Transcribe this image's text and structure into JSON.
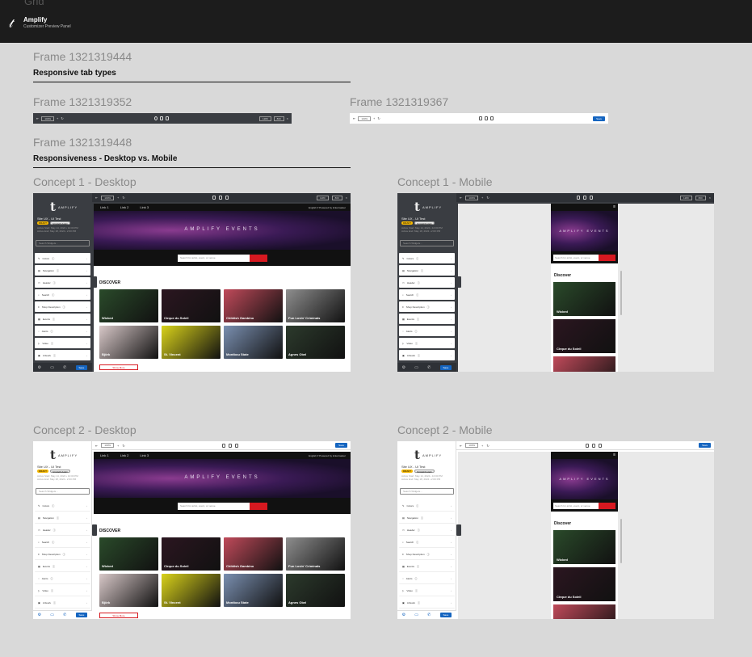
{
  "app": {
    "ghost_title": "Grid",
    "title": "Amplify",
    "subtitle": "Customizer Preview Panel"
  },
  "frames": {
    "f1": "Frame 1321319444",
    "f2": "Frame 1321319352",
    "f3": "Frame 1321319367",
    "f4": "Frame 1321319448"
  },
  "sections": {
    "tab_types": "Responsive tab types",
    "responsiveness": "Responsiveness - Desktop vs. Mobile"
  },
  "concepts": {
    "c1d": "Concept 1 - Desktop",
    "c1m": "Concept 1 - Mobile",
    "c2d": "Concept 2 - Desktop",
    "c2m": "Concept 2 - Mobile"
  },
  "toolbar": {
    "zoom": "100%",
    "field1": "1280",
    "field2": "800",
    "save": "Save"
  },
  "sidebar": {
    "brand": "AMPLIFY",
    "site_name": "Site UX - UI Test",
    "badge_a": "DRAFT",
    "badge_b": "SCHEDULED",
    "date1": "Active Start: May 14, 2024 • 10:00 PM",
    "date2": "Active End: May 18, 2024 • 2:00 PM",
    "search_placeholder": "Search Widgets...",
    "items": [
      {
        "label": "Colors"
      },
      {
        "label": "Navigation"
      },
      {
        "label": "Header"
      },
      {
        "label": "Search"
      },
      {
        "label": "Shop Description"
      },
      {
        "label": "Events"
      },
      {
        "label": "Alerts"
      },
      {
        "label": "Video"
      },
      {
        "label": "Artwork"
      }
    ],
    "save": "Save"
  },
  "site": {
    "nav": [
      "Link 1",
      "Link 2",
      "Link 3"
    ],
    "nav_right": "English ▾   Powered by ticketmaster",
    "hero": "AMPLIFY EVENTS",
    "search_placeholder": "Search for artist, event, or venue",
    "discover_caps": "DISCOVER",
    "discover": "Discover",
    "more": "Show More",
    "tiles": [
      {
        "name": "Wicked",
        "color": "#2a4a2a"
      },
      {
        "name": "Cirque du Soleil",
        "color": "#2b1620"
      },
      {
        "name": "Childish Gambino",
        "color": "#c04a5a"
      },
      {
        "name": "Fun Lovin' Criminals",
        "color": "#8e8e8e"
      },
      {
        "name": "Björk",
        "color": "#d8c8c8"
      },
      {
        "name": "St. Vincent",
        "color": "#d9d21a"
      },
      {
        "name": "Montbou State",
        "color": "#7a8fb0"
      },
      {
        "name": "Agnes Obel",
        "color": "#2c3a2c"
      }
    ]
  }
}
